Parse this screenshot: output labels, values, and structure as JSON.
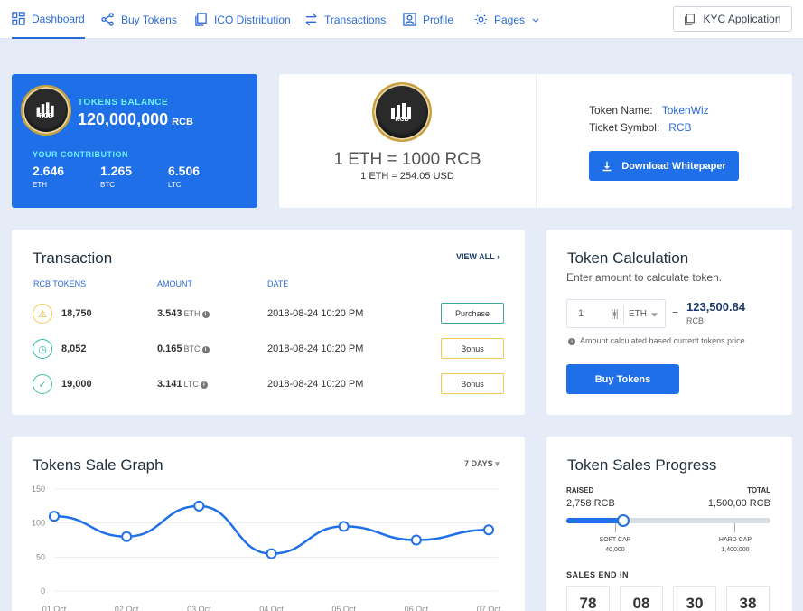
{
  "nav": {
    "items": [
      {
        "label": "Dashboard",
        "icon": "dashboard-icon",
        "active": true
      },
      {
        "label": "Buy Tokens",
        "icon": "share-icon"
      },
      {
        "label": "ICO Distribution",
        "icon": "copy-icon"
      },
      {
        "label": "Transactions",
        "icon": "swap-icon"
      },
      {
        "label": "Profile",
        "icon": "user-icon"
      },
      {
        "label": "Pages",
        "icon": "gear-icon"
      }
    ],
    "kyc_label": "KYC Application"
  },
  "balance": {
    "coin_label": "RCB",
    "title": "TOKENS BALANCE",
    "value": "120,000,000",
    "unit": "RCB",
    "contribution_title": "YOUR CONTRIBUTION",
    "contributions": [
      {
        "value": "2.646",
        "unit": "ETH"
      },
      {
        "value": "1.265",
        "unit": "BTC"
      },
      {
        "value": "6.506",
        "unit": "LTC"
      }
    ]
  },
  "rate": {
    "main": "1 ETH = 1000 RCB",
    "sub": "1 ETH = 254.05 USD",
    "token_name_label": "Token Name:",
    "token_name": "TokenWiz",
    "ticket_symbol_label": "Ticket Symbol:",
    "ticket_symbol": "RCB",
    "download_label": "Download Whitepaper"
  },
  "transaction": {
    "title": "Transaction",
    "view_all": "VIEW ALL",
    "headers": [
      "RCB TOKENS",
      "AMOUNT",
      "DATE"
    ],
    "rows": [
      {
        "tokens": "18,750",
        "amount": "3.543",
        "currency": "ETH",
        "date": "2018-08-24 10:20 PM",
        "type": "Purchase",
        "status_color": "#f2c94c",
        "btn_color": "#3aa89a"
      },
      {
        "tokens": "8,052",
        "amount": "0.165",
        "currency": "BTC",
        "date": "2018-08-24 10:20 PM",
        "type": "Bonus",
        "status_color": "#2bb7b0",
        "btn_color": "#f2c94c"
      },
      {
        "tokens": "19,000",
        "amount": "3.141",
        "currency": "LTC",
        "date": "2018-08-24 10:20 PM",
        "type": "Bonus",
        "status_color": "#41c29a",
        "btn_color": "#f2c94c"
      }
    ]
  },
  "calculation": {
    "title": "Token Calculation",
    "subtitle": "Enter amount to calculate token.",
    "input_value": "1",
    "currency": "ETH",
    "equals": "=",
    "result": "123,500.84",
    "result_unit": "RCB",
    "note": "Amount calculated based current tokens price",
    "buy_label": "Buy Tokens"
  },
  "graph": {
    "title": "Tokens Sale Graph",
    "range": "7 DAYS"
  },
  "chart_data": {
    "type": "line",
    "title": "Tokens Sale Graph",
    "x": [
      "01 Oct",
      "02 Oct",
      "03 Oct",
      "04 Oct",
      "05 Oct",
      "06 Oct",
      "07 Oct"
    ],
    "values": [
      110,
      80,
      125,
      55,
      95,
      75,
      90
    ],
    "ylim": [
      0,
      150
    ],
    "yticks": [
      0,
      50,
      100,
      150
    ],
    "grid": true,
    "color": "#1f6fe8"
  },
  "progress": {
    "title": "Token Sales Progress",
    "raised_label": "RAISED",
    "raised_value": "2,758 RCB",
    "total_label": "TOTAL",
    "total_value": "1,500,00 RCB",
    "fill_fraction": 0.28,
    "soft_cap_label": "SOFT CAP",
    "soft_cap_value": "40,000",
    "hard_cap_label": "HARD CAP",
    "hard_cap_value": "1,400,000",
    "sales_end_label": "SALES END IN",
    "countdown": [
      "78",
      "08",
      "30",
      "38"
    ]
  }
}
